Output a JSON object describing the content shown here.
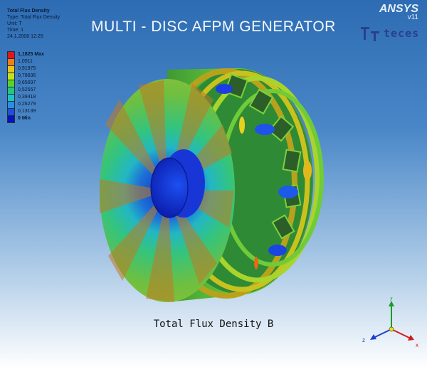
{
  "info": {
    "title": "Total Flux Density",
    "type": "Type: Total Flux Density",
    "unit": "Unit: T",
    "time": "Time: 1",
    "date": "24.1.2008 12:25"
  },
  "title": "MULTI - DISC  AFPM  GENERATOR",
  "ansys": {
    "brand": "ANSYS",
    "version": "v11"
  },
  "teces_logo": "teces",
  "legend": {
    "items": [
      {
        "label": "1,1825 Max",
        "color": "#e2171a",
        "bold": true
      },
      {
        "label": "1,0511",
        "color": "#f07f14",
        "bold": false
      },
      {
        "label": "0,91975",
        "color": "#e9c419",
        "bold": false
      },
      {
        "label": "0,78836",
        "color": "#c4e21c",
        "bold": false
      },
      {
        "label": "0,65697",
        "color": "#5bd22c",
        "bold": false
      },
      {
        "label": "0,52557",
        "color": "#25c77a",
        "bold": false
      },
      {
        "label": "0,39418",
        "color": "#1ec4c4",
        "bold": false
      },
      {
        "label": "0,26279",
        "color": "#2a8fe0",
        "bold": false
      },
      {
        "label": "0,13139",
        "color": "#1e4fe0",
        "bold": false
      },
      {
        "label": "0 Min",
        "color": "#0a12b8",
        "bold": true
      }
    ]
  },
  "caption": "Total Flux Density  B",
  "axes": {
    "y": "y",
    "z": "z",
    "x": "x"
  }
}
